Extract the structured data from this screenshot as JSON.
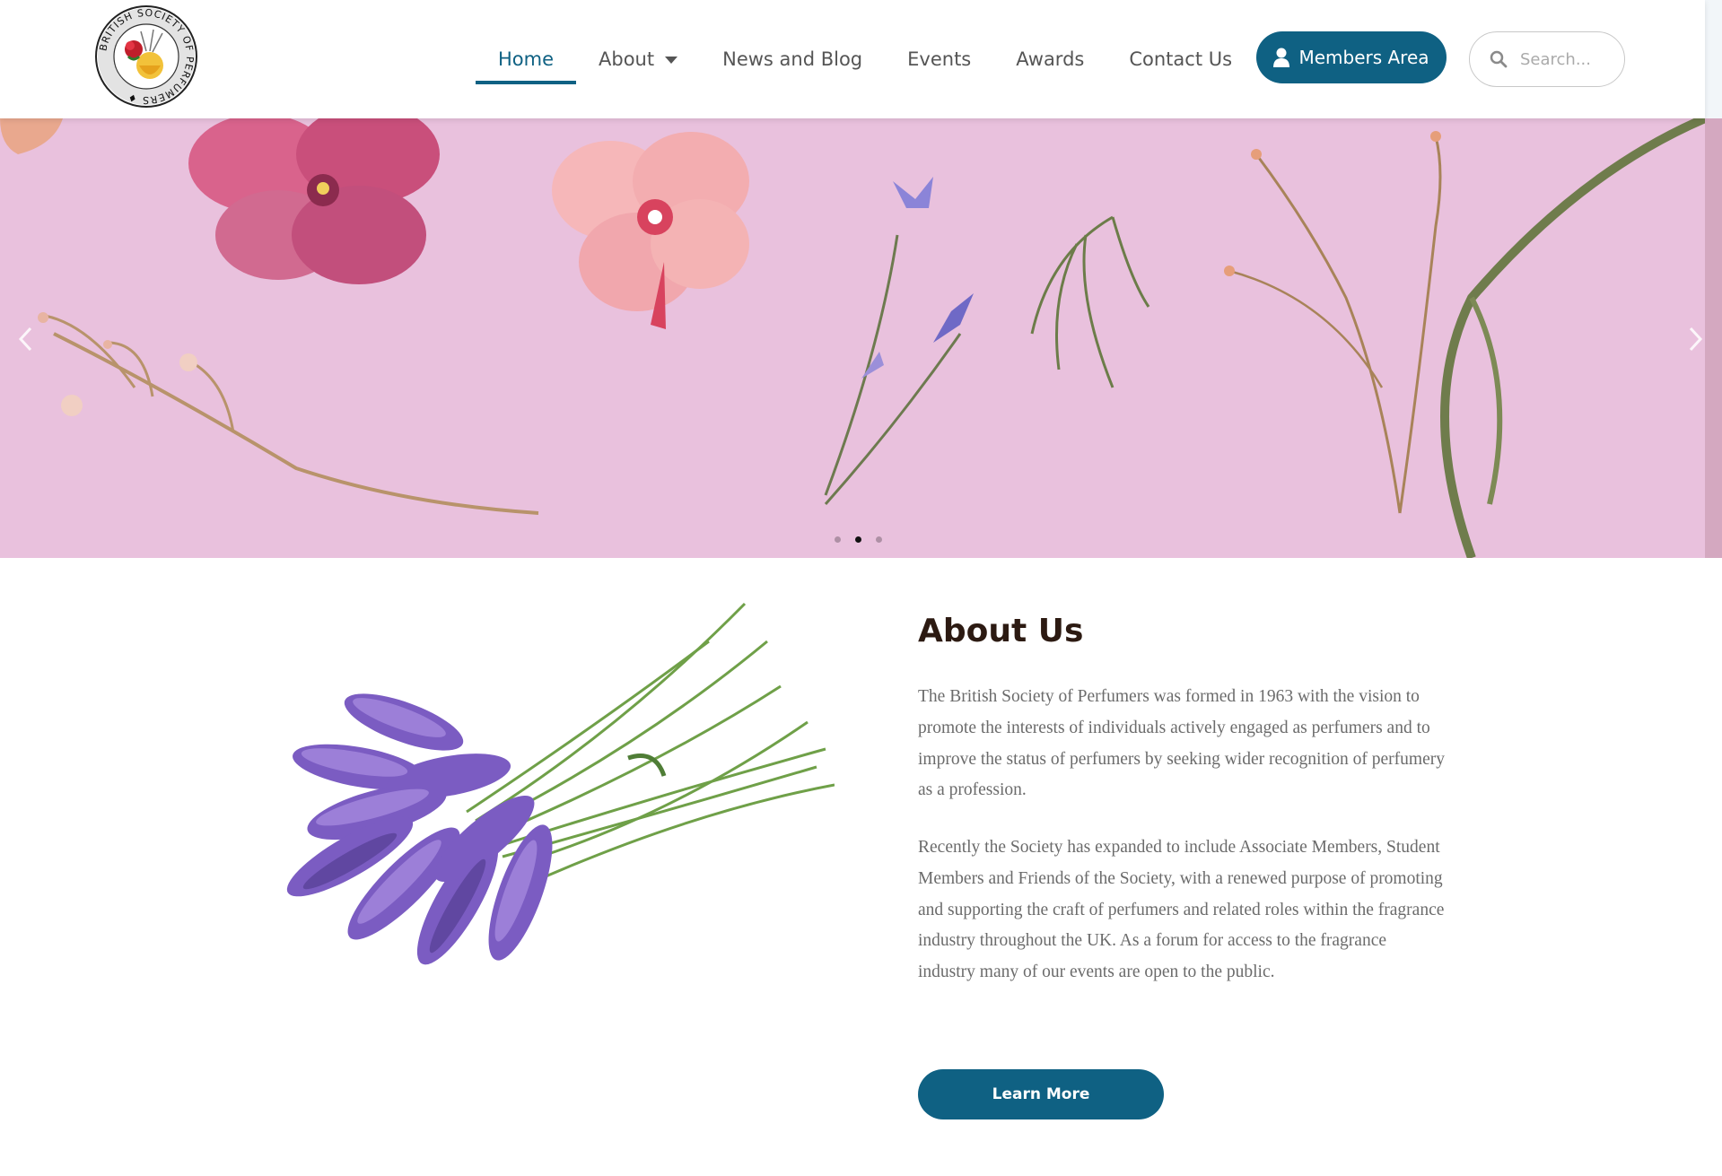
{
  "header": {
    "logo_text": "BRITISH SOCIETY OF PERFUMERS",
    "nav": [
      {
        "label": "Home"
      },
      {
        "label": "About"
      },
      {
        "label": "News and Blog"
      },
      {
        "label": "Events"
      },
      {
        "label": "Awards"
      },
      {
        "label": "Contact Us"
      }
    ],
    "members_label": "Members Area",
    "search_placeholder": "Search..."
  },
  "hero": {
    "slide_count": 3,
    "active_slide": 2
  },
  "about": {
    "title": "About Us",
    "paragraph1": "The British Society of Perfumers was formed in 1963 with the vision to promote the interests of individuals actively engaged as perfumers and to improve the status of perfumers by seeking wider recognition of perfumery as a profession.",
    "paragraph2": "Recently the Society has expanded to include Associate Members, Student Members and Friends of the Society, with a renewed purpose of promoting and supporting the craft of perfumers and related roles within the fragrance industry throughout the UK. As a forum for access to the fragrance industry many of our events are open to the public.",
    "button_label": "Learn More"
  },
  "colors": {
    "brand": "#0f6183",
    "hero_bg": "#e9c1dd",
    "title": "#2c1a12"
  }
}
